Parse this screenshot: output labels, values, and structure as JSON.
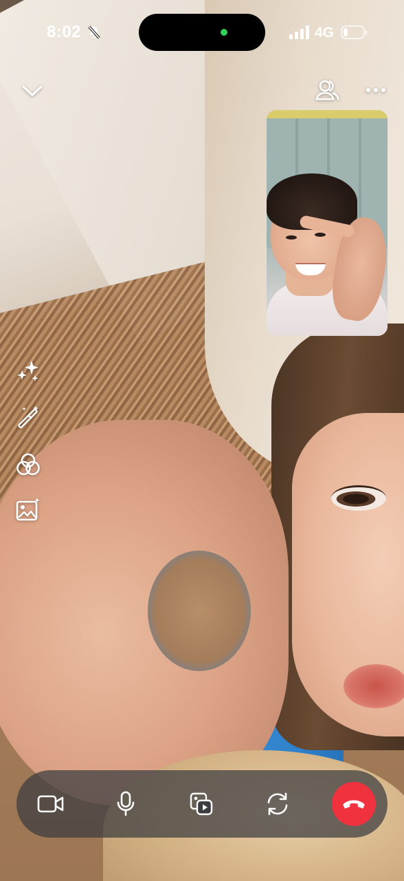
{
  "status_bar": {
    "time": "8:02",
    "network": "4G",
    "icons": [
      "bell-off-icon",
      "signal-icon",
      "battery-icon"
    ],
    "indicator_color": "#2fd158"
  },
  "top_controls": {
    "collapse_icon": "chevron-down-icon",
    "participants_icon": "people-icon",
    "more_icon": "more-horizontal-icon"
  },
  "effects_toolbar": {
    "items": [
      {
        "icon": "sparkles-icon"
      },
      {
        "icon": "magic-wand-icon"
      },
      {
        "icon": "filters-icon"
      },
      {
        "icon": "background-image-icon"
      }
    ]
  },
  "call_controls": {
    "items": [
      {
        "icon": "video-camera-icon"
      },
      {
        "icon": "microphone-icon"
      },
      {
        "icon": "media-share-icon"
      },
      {
        "icon": "flip-camera-icon"
      },
      {
        "icon": "end-call-icon"
      }
    ],
    "end_call_color": "#f0323f",
    "bar_color": "rgba(60,60,64,0.72)"
  }
}
